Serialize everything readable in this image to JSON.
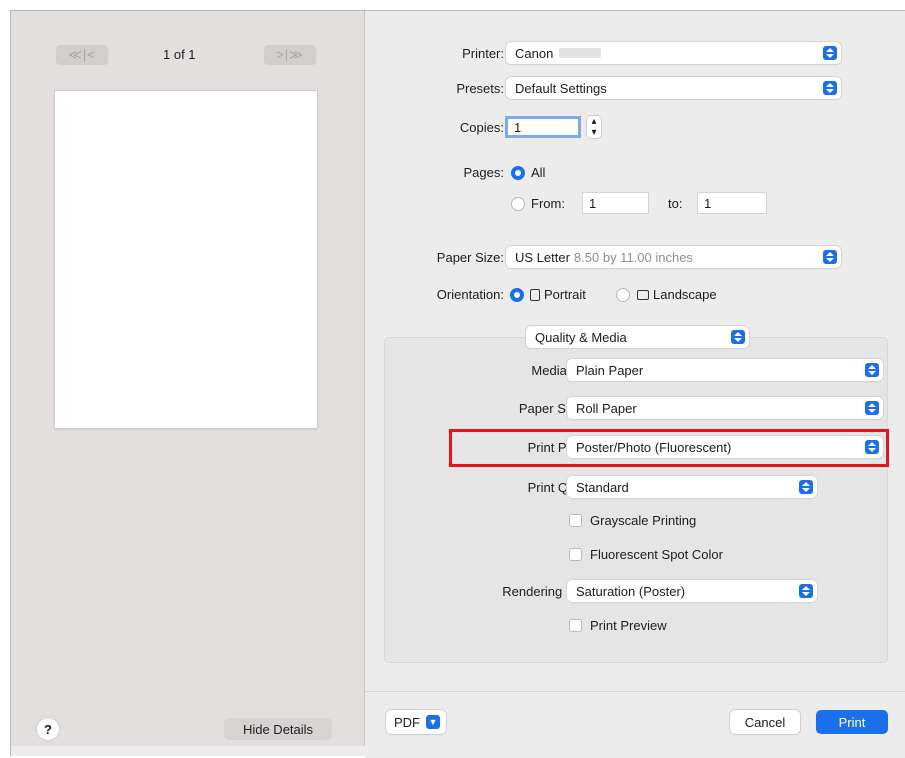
{
  "sidebar": {
    "first_nav": "≪|<",
    "page_counter": "1 of 1",
    "last_nav": ">|≫",
    "help_label": "?",
    "hide_details_label": "Hide Details"
  },
  "printer": {
    "label": "Printer:",
    "value": "Canon"
  },
  "presets": {
    "label": "Presets:",
    "value": "Default Settings"
  },
  "copies": {
    "label": "Copies:",
    "value": "1"
  },
  "pages": {
    "label": "Pages:",
    "all_label": "All",
    "from_label": "From:",
    "from_value": "1",
    "to_label": "to:",
    "to_value": "1"
  },
  "paper_size": {
    "label": "Paper Size:",
    "value": "US Letter",
    "detail": "8.50 by 11.00 inches"
  },
  "orientation": {
    "label": "Orientation:",
    "portrait_label": "Portrait",
    "landscape_label": "Landscape"
  },
  "section_selector": {
    "value": "Quality & Media"
  },
  "quality": {
    "media_type": {
      "label": "Media Type:",
      "value": "Plain Paper"
    },
    "paper_source": {
      "label": "Paper Source:",
      "value": "Roll Paper"
    },
    "print_priority": {
      "label": "Print Priority:",
      "value": "Poster/Photo (Fluorescent)"
    },
    "print_quality": {
      "label": "Print Quality:",
      "value": "Standard"
    },
    "grayscale_label": "Grayscale Printing",
    "fluorescent_label": "Fluorescent Spot Color",
    "rendering_intent": {
      "label": "Rendering Intent:",
      "value": "Saturation (Poster)"
    },
    "print_preview_label": "Print Preview"
  },
  "footer": {
    "pdf_label": "PDF",
    "cancel_label": "Cancel",
    "print_label": "Print"
  },
  "colors": {
    "accent": "#1b6fe8",
    "highlight": "#e8141b",
    "sidebar_bg": "#e4dfdf"
  }
}
